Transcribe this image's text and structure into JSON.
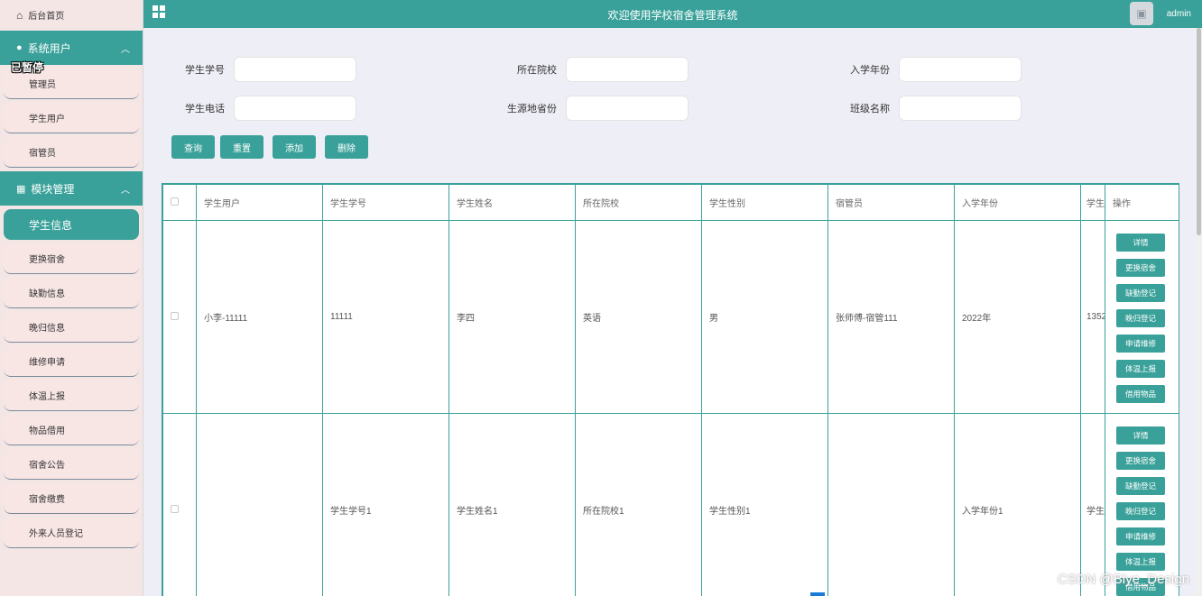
{
  "app": {
    "title": "欢迎使用学校宿舍管理系统",
    "user": "admin",
    "paused_label": "已暂停"
  },
  "sidebar": {
    "home": "后台首页",
    "groups": [
      {
        "label": "系统用户",
        "items": [
          "管理员",
          "学生用户",
          "宿管员"
        ]
      },
      {
        "label": "模块管理",
        "items": [
          "学生信息",
          "更换宿舍",
          "缺勤信息",
          "晚归信息",
          "维修申请",
          "体温上报",
          "物品借用",
          "宿舍公告",
          "宿舍缴费",
          "外来人员登记"
        ]
      }
    ],
    "active": "学生信息"
  },
  "search": {
    "fields": [
      {
        "label": "学生学号",
        "value": ""
      },
      {
        "label": "所在院校",
        "value": ""
      },
      {
        "label": "入学年份",
        "value": ""
      },
      {
        "label": "学生电话",
        "value": ""
      },
      {
        "label": "生源地省份",
        "value": ""
      },
      {
        "label": "班级名称",
        "value": ""
      }
    ],
    "buttons": {
      "query": "查询",
      "reset": "重置",
      "add": "添加",
      "delete": "删除"
    }
  },
  "table": {
    "headers": [
      "学生用户",
      "学生学号",
      "学生姓名",
      "所在院校",
      "学生性别",
      "宿管员",
      "入学年份",
      "学生",
      "操作"
    ],
    "rows": [
      [
        "小李-11111",
        "11111",
        "李四",
        "英语",
        "男",
        "张师傅-宿管111",
        "2022年",
        "1352"
      ],
      [
        "",
        "学生学号1",
        "学生姓名1",
        "所在院校1",
        "学生性别1",
        "",
        "入学年份1",
        "学生"
      ]
    ],
    "row_actions": [
      "详情",
      "更换宿舍",
      "缺勤登记",
      "晚归登记",
      "申请维修",
      "体温上报",
      "借用物品"
    ]
  },
  "watermark": "CSDN @Biye_Design",
  "colors": {
    "accent": "#3aa19a",
    "sidebar_bg": "#f5e6e6",
    "main_bg": "#eeeef6"
  }
}
